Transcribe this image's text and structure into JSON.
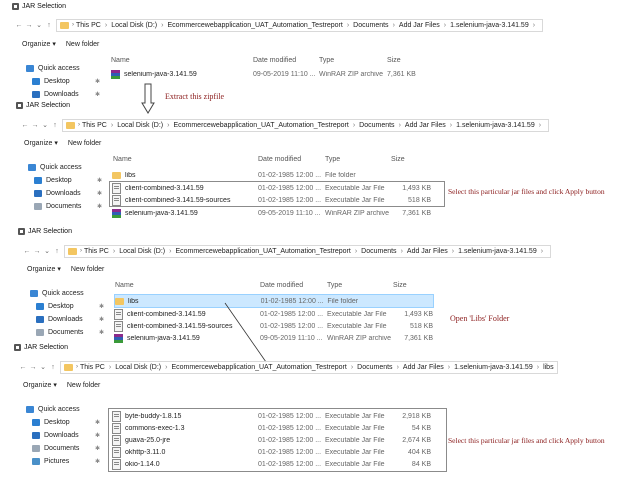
{
  "window_title": "JAR Selection",
  "toolbar": {
    "organize": "Organize ▾",
    "new_folder": "New folder"
  },
  "columns": {
    "name": "Name",
    "date": "Date modified",
    "type": "Type",
    "size": "Size"
  },
  "sidebar": {
    "quick_access": "Quick access",
    "desktop": "Desktop",
    "downloads": "Downloads",
    "documents": "Documents",
    "pictures": "Pictures"
  },
  "panel1": {
    "breadcrumb": [
      "This PC",
      "Local Disk (D:)",
      "Ecommercewebapplication_UAT_Automation_Testreport",
      "Documents",
      "Add Jar Files",
      "1.selenium-java-3.141.59"
    ],
    "rows": [
      {
        "name": "selenium-java-3.141.59",
        "date": "09-05-2019 11:10 ...",
        "type": "WinRAR ZIP archive",
        "size": "7,361 KB"
      }
    ]
  },
  "note1": "Extract  this zipfile",
  "panel2": {
    "breadcrumb": [
      "This PC",
      "Local Disk (D:)",
      "Ecommercewebapplication_UAT_Automation_Testreport",
      "Documents",
      "Add Jar Files",
      "1.selenium-java-3.141.59"
    ],
    "rows": [
      {
        "name": "libs",
        "date": "01-02-1985 12:00 ...",
        "type": "File folder",
        "size": ""
      },
      {
        "name": "client-combined-3.141.59",
        "date": "01-02-1985 12:00 ...",
        "type": "Executable Jar File",
        "size": "1,493 KB"
      },
      {
        "name": "client-combined-3.141.59-sources",
        "date": "01-02-1985 12:00 ...",
        "type": "Executable Jar File",
        "size": "518 KB"
      },
      {
        "name": "selenium-java-3.141.59",
        "date": "09-05-2019 11:10 ...",
        "type": "WinRAR ZIP archive",
        "size": "7,361 KB"
      }
    ]
  },
  "note2": "Select this particular jar files and click Apply button",
  "panel3": {
    "breadcrumb": [
      "This PC",
      "Local Disk (D:)",
      "Ecommercewebapplication_UAT_Automation_Testreport",
      "Documents",
      "Add Jar Files",
      "1.selenium-java-3.141.59"
    ],
    "rows": [
      {
        "name": "libs",
        "date": "01-02-1985 12:00 ...",
        "type": "File folder",
        "size": ""
      },
      {
        "name": "client-combined-3.141.59",
        "date": "01-02-1985 12:00 ...",
        "type": "Executable Jar File",
        "size": "1,493 KB"
      },
      {
        "name": "client-combined-3.141.59-sources",
        "date": "01-02-1985 12:00 ...",
        "type": "Executable Jar File",
        "size": "518 KB"
      },
      {
        "name": "selenium-java-3.141.59",
        "date": "09-05-2019 11:10 ...",
        "type": "WinRAR ZIP archive",
        "size": "7,361 KB"
      }
    ]
  },
  "note3": "Open 'Libs' Folder",
  "panel4": {
    "breadcrumb": [
      "This PC",
      "Local Disk (D:)",
      "Ecommercewebapplication_UAT_Automation_Testreport",
      "Documents",
      "Add Jar Files",
      "1.selenium-java-3.141.59",
      "libs"
    ],
    "rows": [
      {
        "name": "byte-buddy-1.8.15",
        "date": "01-02-1985 12:00 ...",
        "type": "Executable Jar File",
        "size": "2,918 KB"
      },
      {
        "name": "commons-exec-1.3",
        "date": "01-02-1985 12:00 ...",
        "type": "Executable Jar File",
        "size": "54 KB"
      },
      {
        "name": "guava-25.0-jre",
        "date": "01-02-1985 12:00 ...",
        "type": "Executable Jar File",
        "size": "2,674 KB"
      },
      {
        "name": "okhttp-3.11.0",
        "date": "01-02-1985 12:00 ...",
        "type": "Executable Jar File",
        "size": "404 KB"
      },
      {
        "name": "okio-1.14.0",
        "date": "01-02-1985 12:00 ...",
        "type": "Executable Jar File",
        "size": "84 KB"
      }
    ]
  },
  "note4": "Select this particular jar files and click Apply button"
}
